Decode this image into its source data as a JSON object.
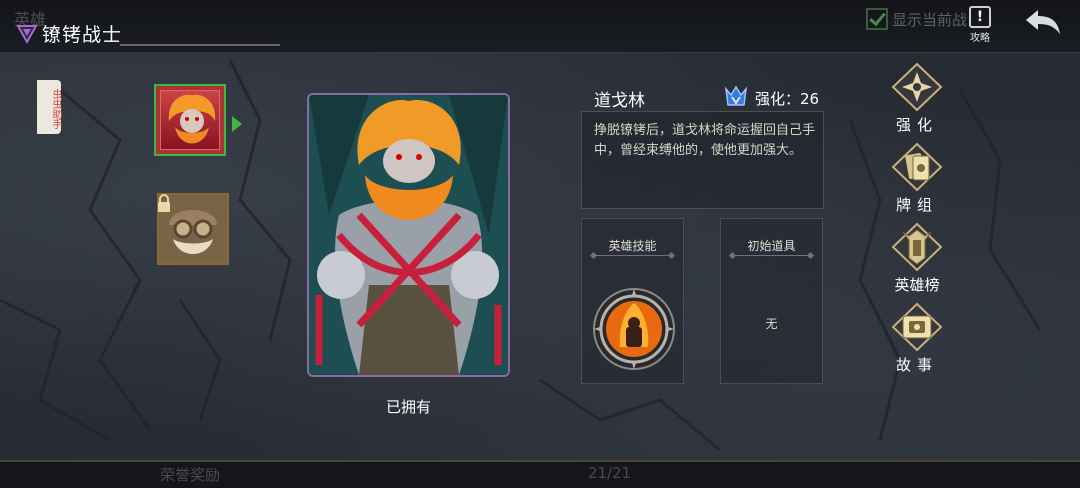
{
  "header": {
    "ghost_title": "英雄",
    "title": "镣铐战士",
    "show_current_label": "显示当前战",
    "show_current_checked": true,
    "guide_label": "攻略"
  },
  "footer": {
    "ghost_left": "荣誉奖励",
    "page_count": "21/21"
  },
  "helper_tab": "虫虫助手",
  "hero": {
    "name": "道戈林",
    "enhance_label": "强化：26",
    "description": "挣脱镣铐后，道戈林将命运握回自己手中，曾经束缚他的，使他更加强大。",
    "owned_label": "已拥有"
  },
  "skill_card": {
    "title": "英雄技能"
  },
  "item_card": {
    "title": "初始道具",
    "value": "无"
  },
  "menu": [
    {
      "label": "强化",
      "icon": "enhance-icon"
    },
    {
      "label": "牌组",
      "icon": "deck-icon"
    },
    {
      "label": "英雄榜",
      "icon": "leaderboard-icon"
    },
    {
      "label": "故事",
      "icon": "story-icon"
    }
  ],
  "colors": {
    "selected": "#3fb83f",
    "gold": "#c9b07a",
    "portrait_border": "#8a6ba0"
  }
}
